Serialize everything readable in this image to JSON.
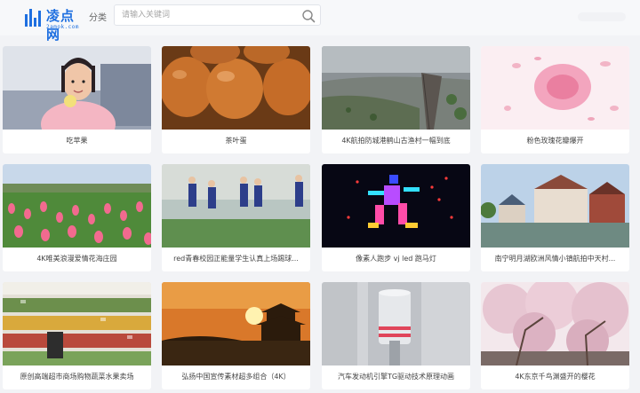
{
  "header": {
    "logo_text": "凌点网",
    "logo_sub": "2amok.com",
    "category_label": "分类",
    "search_placeholder": "请输入关键词"
  },
  "cards": [
    {
      "title": "吃苹果",
      "thumb": "girl-eating-apple"
    },
    {
      "title": "茶叶蛋",
      "thumb": "tea-eggs"
    },
    {
      "title": "4K航拍防城港鹤山古渔村一幅到底",
      "thumb": "aerial-fishing-village"
    },
    {
      "title": "粉色玫瑰花瓣爆开",
      "thumb": "pink-rose-petals"
    },
    {
      "title": "4K唯美浪漫爱情花海庄园",
      "thumb": "tulip-field"
    },
    {
      "title": "red青春校园正能量学生认真上场踢球...",
      "thumb": "girls-playing-football"
    },
    {
      "title": "像素人跑步 vj led 跑马灯",
      "thumb": "pixel-runner"
    },
    {
      "title": "南宁明月湖欧洲风情小镇航拍中天村...",
      "thumb": "european-town"
    },
    {
      "title": "原创高端超市商场购物蔬菜水果卖场",
      "thumb": "supermarket-produce"
    },
    {
      "title": "弘扬中国宣传素材超多组合（4K）",
      "thumb": "sunset-pavilion"
    },
    {
      "title": "汽车发动机引擎TG驱动技术原理动画",
      "thumb": "engine-piston"
    },
    {
      "title": "4K东京千鸟渊盛开的樱花",
      "thumb": "cherry-blossom"
    }
  ]
}
